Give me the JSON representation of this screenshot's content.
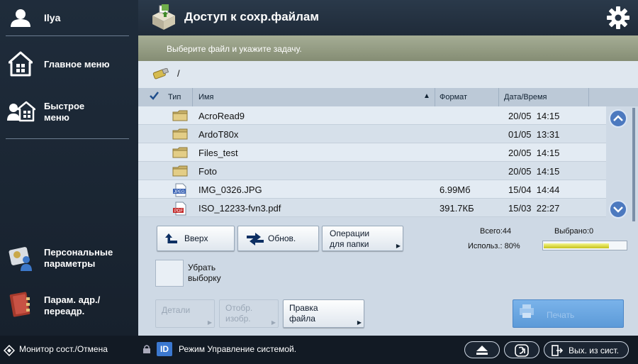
{
  "sidebar": {
    "user": "Ilya",
    "main_menu": "Главное меню",
    "quick_menu": "Быстрое меню",
    "personal_settings": "Персональные параметры",
    "address_settings": "Парам. адр./переадр."
  },
  "header": {
    "title": "Доступ к сохр.файлам"
  },
  "instruction": "Выберите файл и укажите задачу.",
  "path": "/",
  "columns": {
    "type": "Тип",
    "name": "Имя",
    "format": "Формат",
    "datetime": "Дата/Время"
  },
  "files": [
    {
      "icon": "folder-icon",
      "name": "AcroRead9",
      "format": "",
      "date": "20/05",
      "time": "14:15"
    },
    {
      "icon": "folder-icon",
      "name": "ArdoT80x",
      "format": "",
      "date": "01/05",
      "time": "13:31"
    },
    {
      "icon": "folder-icon",
      "name": "Files_test",
      "format": "",
      "date": "20/05",
      "time": "14:15"
    },
    {
      "icon": "folder-icon",
      "name": "Foto",
      "format": "",
      "date": "20/05",
      "time": "14:15"
    },
    {
      "icon": "jpeg-file-icon",
      "name": "IMG_0326.JPG",
      "format": "6.99Мб",
      "date": "15/04",
      "time": "14:44"
    },
    {
      "icon": "pdf-file-icon",
      "name": "ISO_12233-fvn3.pdf",
      "format": "391.7КБ",
      "date": "15/03",
      "time": "22:27"
    }
  ],
  "buttons": {
    "up": "Вверх",
    "refresh": "Обнов.",
    "folder_ops_line1": "Операции",
    "folder_ops_line2": "для папки",
    "clear_selection_line1": "Убрать",
    "clear_selection_line2": "выборку",
    "details": "Детали",
    "preview_line1": "Отобр.",
    "preview_line2": "изобр.",
    "edit_file_line1": "Правка",
    "edit_file_line2": "файла",
    "print": "Печать"
  },
  "stats": {
    "total_label": "Всего:",
    "total": "44",
    "selected_label": "Выбрано:",
    "selected": "0",
    "used_label": "Использ.:",
    "used": "80%",
    "used_fraction": 0.8
  },
  "status_bar": {
    "monitor": "Монитор сост./Отмена",
    "id_badge": "ID",
    "mode": "Режим Управление системой.",
    "logout": "Вых. из сист."
  },
  "colors": {
    "header_bg": "#243344",
    "instruction_bg": "#979f86",
    "accent_blue": "#4c79bf",
    "usage_bar": "#d8d63a"
  }
}
